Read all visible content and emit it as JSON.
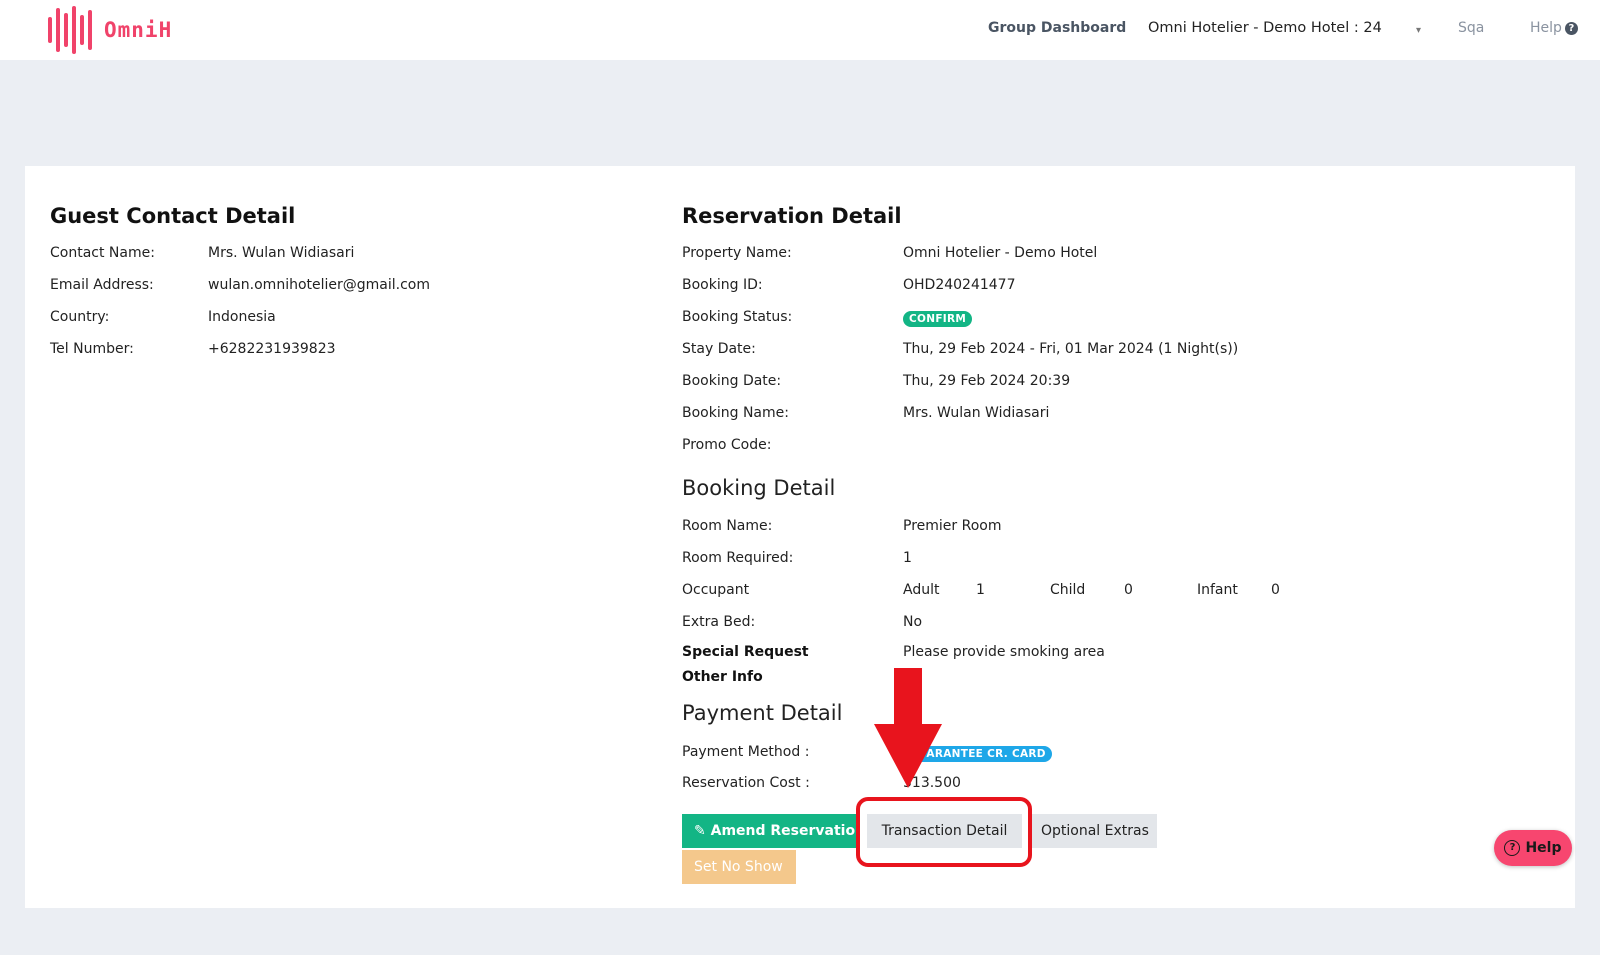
{
  "header": {
    "logo_text": "OmniH",
    "group_dashboard": "Group Dashboard",
    "hotel_selector": "Omni Hotelier - Demo Hotel : 24",
    "hotel_caret": "▾",
    "user": "Sqa",
    "help": "Help",
    "help_icon_char": "?"
  },
  "guest": {
    "title": "Guest Contact Detail",
    "contact_name_label": "Contact Name:",
    "contact_name": "Mrs. Wulan Widiasari",
    "email_label": "Email Address:",
    "email": "wulan.omnihotelier@gmail.com",
    "country_label": "Country:",
    "country": "Indonesia",
    "tel_label": "Tel Number:",
    "tel": "+6282231939823"
  },
  "reservation": {
    "title": "Reservation Detail",
    "property_label": "Property Name:",
    "property": "Omni Hotelier - Demo Hotel",
    "booking_id_label": "Booking ID:",
    "booking_id": "OHD240241477",
    "status_label": "Booking Status:",
    "status": "CONFIRM",
    "status_color": "#13b585",
    "stay_label": "Stay Date:",
    "stay": "Thu, 29 Feb 2024 - Fri, 01 Mar 2024 (1 Night(s))",
    "booking_date_label": "Booking Date:",
    "booking_date": "Thu, 29 Feb 2024 20:39",
    "booking_name_label": "Booking Name:",
    "booking_name": "Mrs. Wulan Widiasari",
    "promo_label": "Promo Code:",
    "promo": ""
  },
  "booking": {
    "title": "Booking Detail",
    "room_name_label": "Room Name:",
    "room_name": "Premier Room",
    "room_required_label": "Room Required:",
    "room_required": "1",
    "occupant_label": "Occupant",
    "adult_label": "Adult",
    "adult": "1",
    "child_label": "Child",
    "child": "0",
    "infant_label": "Infant",
    "infant": "0",
    "extra_bed_label": "Extra Bed:",
    "extra_bed": "No",
    "special_request_label": "Special Request",
    "special_request": "Please provide smoking area",
    "other_info_label": "Other Info",
    "other_info": ""
  },
  "payment": {
    "title": "Payment Detail",
    "method_label": "Payment Method :",
    "method": "GUARANTEE CR. CARD",
    "method_color": "#1ea7e8",
    "cost_label": "Reservation Cost :",
    "cost": "313.500"
  },
  "actions": {
    "amend": "Amend Reservation",
    "amend_icon": "pencil-icon",
    "transaction": "Transaction Detail",
    "extras": "Optional Extras",
    "no_show": "Set No Show"
  },
  "help_fab": {
    "label": "Help",
    "icon_char": "?"
  },
  "colors": {
    "brand": "#f0436a",
    "annotation": "#e8141d"
  }
}
